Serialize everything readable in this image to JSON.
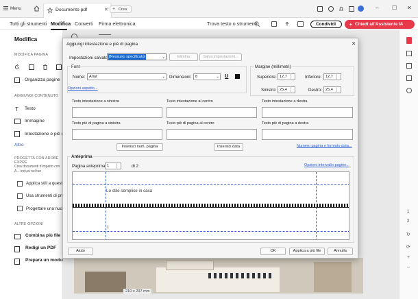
{
  "titlebar": {
    "menu_label": "Menu",
    "tab_title": "Documento pdf",
    "new_tab_label": "Crea"
  },
  "menubar": {
    "items": [
      "Tutti gli strumenti",
      "Modifica",
      "Converti",
      "Firma elettronica"
    ],
    "search_label": "Trova testo o strumenti",
    "share_label": "Condividi",
    "assistant_label": "Chiedi all'Assistente IA"
  },
  "sidebar": {
    "title": "Modifica",
    "section_pages": "MODIFICA PAGINA",
    "organize_pages": "Organizza pagine",
    "section_content": "AGGIUNGI CONTENUTO",
    "text": "Testo",
    "image": "Immagine",
    "header_footer": "Intestazione e piè di pa",
    "more": "Altro",
    "section_express": "PROGETTA CON ADOBE EXPRE",
    "express_desc": "Crea documenti d'impatto con A... inclusi nel tuo abbonamento Ac...",
    "apply_styles": "Applica stili a questo",
    "use_tools": "Usa strumenti di proge",
    "design_new": "Progettare una nuova",
    "section_other": "ALTRE OPZIONI",
    "combine": "Combina più file",
    "redact": "Redigi un PDF",
    "prepare_form": "Prepara un modulo"
  },
  "doc": {
    "page_size": "210 x 297 mm"
  },
  "right_panel": {
    "page_current": "1",
    "page_total": "2"
  },
  "dialog": {
    "title": "Aggiungi intestazione e piè di pagina",
    "saved_settings_label": "Impostazioni salvate:",
    "saved_settings_value": "[Nessuno specificato]",
    "delete_btn": "Elimina",
    "save_settings_btn": "Salva impostazioni...",
    "font_group": "Font",
    "font_name_label": "Nome:",
    "font_name_value": "Arial",
    "font_size_label": "Dimensioni:",
    "font_size_value": "8",
    "appearance_link": "Opzioni aspetto...",
    "margin_group": "Margine (millimetri)",
    "top_label": "Superiore:",
    "top_value": "12,7",
    "bottom_label": "Inferiore:",
    "bottom_value": "12,7",
    "left_label": "Sinistro:",
    "left_value": "25,4",
    "right_label": "Destro:",
    "right_value": "25,4",
    "header_left_label": "Testo intestazione a sinistra",
    "header_center_label": "Testo intestazione al centro",
    "header_right_label": "Testo intestazione a destra",
    "footer_left_label": "Testo piè di pagina a sinistra",
    "footer_center_label": "Testo piè di pagina al centro",
    "footer_right_label": "Testo piè di pagina a destra",
    "insert_page_num_btn": "Inserisci num. pagina",
    "insert_date_btn": "Inserisci data",
    "page_number_format_link": "Numero pagina e formato data...",
    "preview_group": "Anteprima",
    "preview_page_label": "Pagina anteprima",
    "preview_page_value": "1",
    "preview_page_of": "di 2",
    "page_range_link": "Opzioni intervallo pagine...",
    "preview_text": "Lo stile semplice in casa",
    "preview_footer_num": "1",
    "help_btn": "Aiuto",
    "ok_btn": "OK",
    "apply_multiple_btn": "Applica a più file",
    "cancel_btn": "Annulla"
  },
  "colors": {
    "accent_red": "#e8394a",
    "link_blue": "#2c5fd6",
    "selection_blue": "#1666d2"
  }
}
